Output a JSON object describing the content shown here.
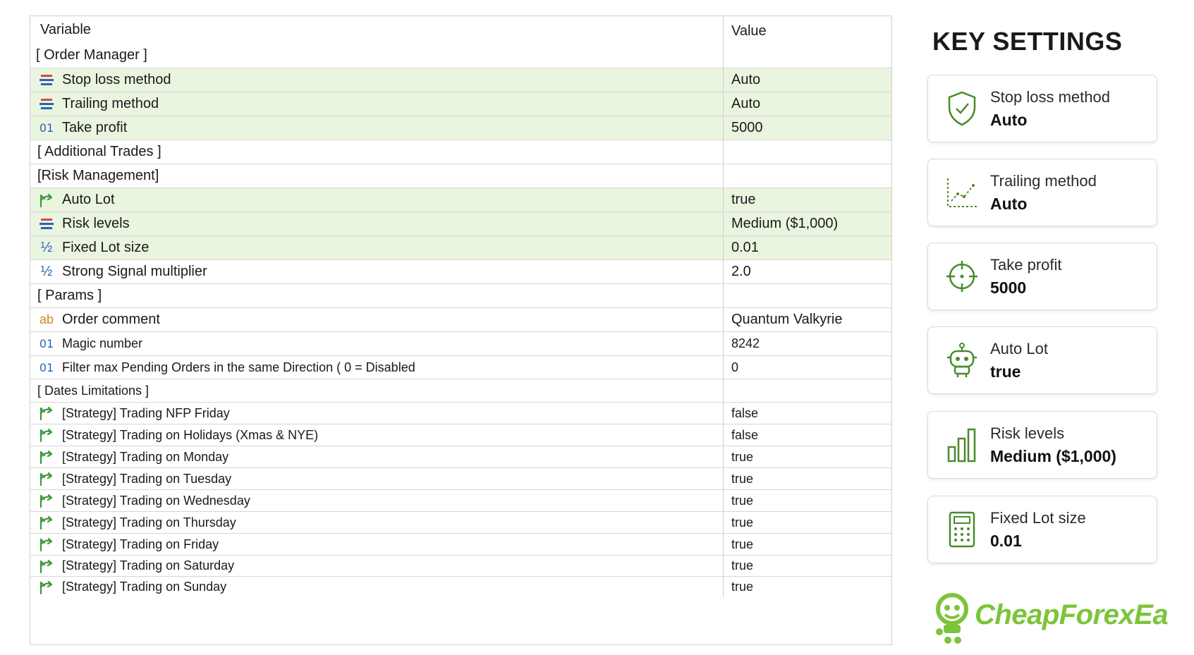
{
  "table": {
    "header": {
      "variable": "Variable",
      "value": "Value",
      "first_section": "[ Order Manager ]"
    },
    "rows": [
      {
        "icon": "list-icon",
        "label": "Stop loss method",
        "value": "Auto",
        "hl": true
      },
      {
        "icon": "list-icon",
        "label": "Trailing method",
        "value": "Auto",
        "hl": true
      },
      {
        "icon": "number-icon",
        "label": "Take profit",
        "value": "5000",
        "hl": true
      },
      {
        "section": true,
        "label": "[ Additional Trades ]"
      },
      {
        "section": true,
        "label": "[Risk Management]"
      },
      {
        "icon": "bool-arrow-icon",
        "label": "Auto Lot",
        "value": "true",
        "hl": true
      },
      {
        "icon": "list-icon",
        "label": "Risk levels",
        "value": "Medium ($1,000)",
        "hl": true
      },
      {
        "icon": "fraction-icon",
        "label": "Fixed Lot size",
        "value": "0.01",
        "hl": true
      },
      {
        "icon": "fraction-icon",
        "label": "Strong Signal multiplier",
        "value": "2.0"
      },
      {
        "section": true,
        "label": "[ Params ]"
      },
      {
        "icon": "string-icon",
        "label": "Order comment",
        "value": "Quantum Valkyrie"
      },
      {
        "icon": "number-icon",
        "label": "Magic number",
        "value": "8242",
        "small": true
      },
      {
        "icon": "number-icon",
        "label": "Filter max Pending Orders in the same Direction ( 0 = Disabled",
        "value": "0",
        "small": true
      },
      {
        "section": true,
        "label": "[ Dates Limitations ]",
        "small": true
      },
      {
        "icon": "bool-arrow-icon",
        "label": "[Strategy] Trading NFP Friday",
        "value": "false",
        "small": true
      },
      {
        "icon": "bool-arrow-icon",
        "label": "[Strategy] Trading on Holidays (Xmas & NYE)",
        "value": "false",
        "small": true
      },
      {
        "icon": "bool-arrow-icon",
        "label": "[Strategy] Trading on Monday",
        "value": "true",
        "small": true
      },
      {
        "icon": "bool-arrow-icon",
        "label": "[Strategy] Trading on Tuesday",
        "value": "true",
        "small": true
      },
      {
        "icon": "bool-arrow-icon",
        "label": "[Strategy] Trading on Wednesday",
        "value": "true",
        "small": true
      },
      {
        "icon": "bool-arrow-icon",
        "label": "[Strategy] Trading on Thursday",
        "value": "true",
        "small": true
      },
      {
        "icon": "bool-arrow-icon",
        "label": "[Strategy] Trading on Friday",
        "value": "true",
        "small": true
      },
      {
        "icon": "bool-arrow-icon",
        "label": "[Strategy] Trading on Saturday",
        "value": "true",
        "small": true
      },
      {
        "icon": "bool-arrow-icon",
        "label": "[Strategy] Trading on Sunday",
        "value": "true",
        "small": true
      }
    ]
  },
  "key_settings": {
    "title": "KEY SETTINGS",
    "cards": [
      {
        "icon": "shield-check-icon",
        "label": "Stop loss method",
        "value": "Auto"
      },
      {
        "icon": "trend-chart-icon",
        "label": "Trailing method",
        "value": "Auto"
      },
      {
        "icon": "crosshair-icon",
        "label": "Take profit",
        "value": "5000"
      },
      {
        "icon": "robot-icon",
        "label": "Auto Lot",
        "value": "true"
      },
      {
        "icon": "bar-chart-icon",
        "label": "Risk levels",
        "value": "Medium ($1,000)"
      },
      {
        "icon": "calculator-icon",
        "label": "Fixed Lot size",
        "value": "0.01"
      }
    ]
  },
  "logo": {
    "text": "CheapForexEa"
  },
  "colors": {
    "highlight": "#eaf5e0",
    "accent_green": "#7cc43a",
    "icon_green": "#3a9a3a",
    "icon_blue": "#2a63b8"
  }
}
